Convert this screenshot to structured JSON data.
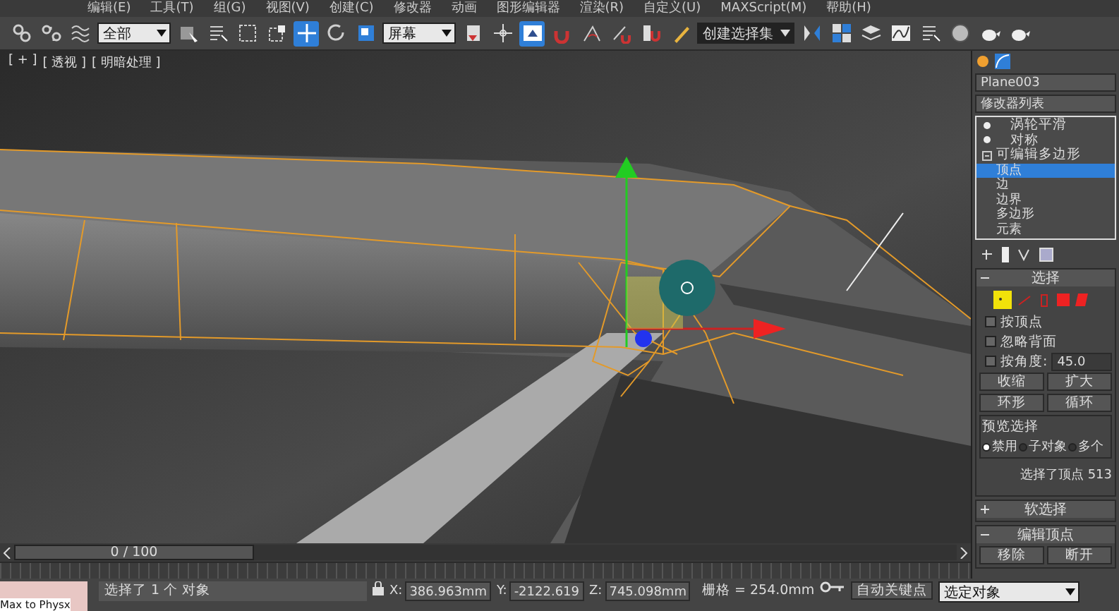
{
  "menu": [
    "编辑(E)",
    "工具(T)",
    "组(G)",
    "视图(V)",
    "创建(C)",
    "修改器",
    "动画",
    "图形编辑器",
    "渲染(R)",
    "自定义(U)",
    "MAXScript(M)",
    "帮助(H)"
  ],
  "toolbar": [
    {
      "kind": "link",
      "selected": false
    },
    {
      "kind": "unlink",
      "selected": false
    },
    {
      "kind": "wave",
      "selected": false
    },
    {
      "kind": "dropdown",
      "value": "全部"
    },
    {
      "kind": "cursor",
      "selected": false
    },
    {
      "kind": "list",
      "selected": false
    },
    {
      "kind": "rect",
      "selected": false
    },
    {
      "kind": "window",
      "selected": false
    },
    {
      "kind": "move",
      "selected": true
    },
    {
      "kind": "rotate",
      "selected": false
    },
    {
      "kind": "scale",
      "selected": false
    },
    {
      "kind": "dropdown",
      "value": "屏幕"
    },
    {
      "kind": "pivot",
      "selected": false
    },
    {
      "kind": "cross",
      "selected": false
    },
    {
      "kind": "screen",
      "selected": true
    },
    {
      "kind": "snap",
      "selected": false
    },
    {
      "kind": "angle",
      "selected": false
    },
    {
      "kind": "percent",
      "selected": false
    },
    {
      "kind": "spinner",
      "selected": false
    },
    {
      "kind": "pencil",
      "selected": false
    },
    {
      "kind": "dropdown",
      "value": "创建选择集"
    },
    {
      "kind": "mirror",
      "selected": false
    },
    {
      "kind": "grid",
      "selected": false
    },
    {
      "kind": "layers",
      "selected": false
    },
    {
      "kind": "chart",
      "selected": false
    },
    {
      "kind": "list",
      "selected": false
    },
    {
      "kind": "sphere",
      "selected": false
    },
    {
      "kind": "teapot",
      "selected": false
    },
    {
      "kind": "teapot",
      "selected": false
    }
  ],
  "viewport": {
    "labels": [
      "[ + ]",
      "[ 透视 ]",
      "[ 明暗处理 ]"
    ]
  },
  "command_panel": {
    "object_name": "Plane003",
    "modifier_list": "修改器列表",
    "stack": [
      {
        "label": "涡轮平滑",
        "kind": "modifier"
      },
      {
        "label": "对称",
        "kind": "modifier"
      },
      {
        "label": "可编辑多边形",
        "kind": "base",
        "expanded": true,
        "children": [
          {
            "label": "顶点",
            "selected": true
          },
          {
            "label": "边",
            "selected": false
          },
          {
            "label": "边界",
            "selected": false
          },
          {
            "label": "多边形",
            "selected": false
          },
          {
            "label": "元素",
            "selected": false
          }
        ]
      }
    ],
    "selection": {
      "title": "选择",
      "expanded": true,
      "checks": [
        {
          "label": "按顶点",
          "checked": false
        },
        {
          "label": "忽略背面",
          "checked": false
        },
        {
          "label": "按角度:",
          "checked": false,
          "value": "45.0"
        }
      ],
      "buttons": [
        "收缩",
        "扩大"
      ],
      "spinner_buttons": [
        "环形",
        "循环"
      ],
      "preview_title": "预览选择",
      "preview": [
        {
          "label": "禁用",
          "selected": true
        },
        {
          "label": "子对象",
          "selected": false
        },
        {
          "label": "多个",
          "selected": false
        }
      ],
      "info": "选择了顶点 513"
    },
    "soft_selection": {
      "title": "软选择",
      "expanded": false
    },
    "edit_vertices": {
      "title": "编辑顶点",
      "expanded": true,
      "buttons": [
        "移除",
        "断开"
      ]
    }
  },
  "timeline": {
    "frame": "0 / 100",
    "level": 0
  },
  "status": {
    "script": "Max to Physx",
    "message": "选择了 1 个 对象",
    "coords": [
      {
        "label": "X:",
        "value": "386.963mm"
      },
      {
        "label": "Y:",
        "value": "-2122.619"
      },
      {
        "label": "Z:",
        "value": "745.098mm"
      }
    ],
    "grid": "栅格 = 254.0mm",
    "auto_key": "自动关键点",
    "key_filter": "选定对象"
  }
}
